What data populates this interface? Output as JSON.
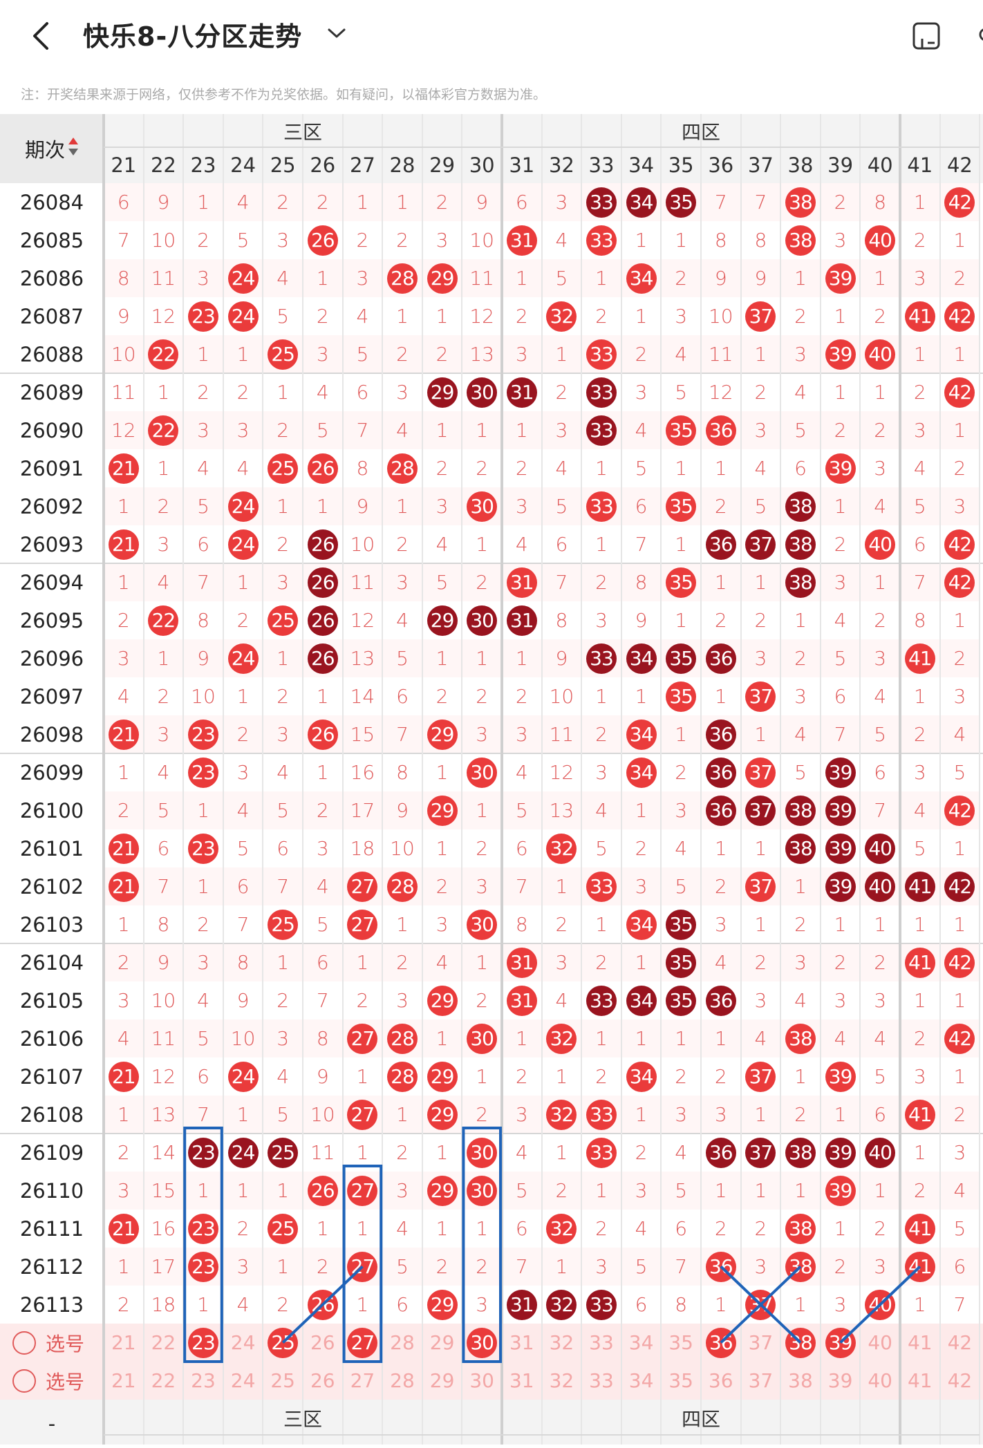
{
  "header": {
    "title": "快乐8-八分区走势",
    "icons": [
      "back-arrow-icon",
      "chevron-down-icon",
      "layout-toggle-icon"
    ]
  },
  "notice": "注：开奖结果来源于网络，仅供参考不作为兑奖依据。如有疑问，以福体彩官方数据为准。",
  "table": {
    "issue_header": "期次",
    "zones": [
      {
        "label": "三区",
        "start": 21,
        "end": 30
      },
      {
        "label": "四区",
        "start": 31,
        "end": 40
      }
    ],
    "columns": [
      "21",
      "22",
      "23",
      "24",
      "25",
      "26",
      "27",
      "28",
      "29",
      "30",
      "31",
      "32",
      "33",
      "34",
      "35",
      "36",
      "37",
      "38",
      "39",
      "40",
      "41",
      "42"
    ],
    "rows": [
      {
        "issue": "26084",
        "cells": [
          "6",
          "9",
          "1",
          "4",
          "2",
          "2",
          "1",
          "1",
          "2",
          "9",
          "6",
          "3",
          "33",
          "34",
          "35",
          "7",
          "7",
          "38",
          "2",
          "8",
          "1",
          "42"
        ],
        "dark": [
          "33",
          "34",
          "35"
        ]
      },
      {
        "issue": "26085",
        "cells": [
          "7",
          "10",
          "2",
          "5",
          "3",
          "26",
          "2",
          "2",
          "3",
          "10",
          "31",
          "4",
          "33",
          "1",
          "1",
          "8",
          "8",
          "38",
          "3",
          "40",
          "2",
          "1"
        ],
        "dark": []
      },
      {
        "issue": "26086",
        "cells": [
          "8",
          "11",
          "3",
          "24",
          "4",
          "1",
          "3",
          "28",
          "29",
          "11",
          "1",
          "5",
          "1",
          "34",
          "2",
          "9",
          "9",
          "1",
          "39",
          "1",
          "3",
          "2"
        ],
        "dark": []
      },
      {
        "issue": "26087",
        "cells": [
          "9",
          "12",
          "23",
          "24",
          "5",
          "2",
          "4",
          "1",
          "1",
          "12",
          "2",
          "32",
          "2",
          "1",
          "3",
          "10",
          "37",
          "2",
          "1",
          "2",
          "41",
          "42"
        ],
        "dark": []
      },
      {
        "issue": "26088",
        "cells": [
          "10",
          "22",
          "1",
          "1",
          "25",
          "3",
          "5",
          "2",
          "2",
          "13",
          "3",
          "1",
          "33",
          "2",
          "4",
          "11",
          "1",
          "3",
          "39",
          "40",
          "1",
          "1"
        ],
        "dark": []
      },
      {
        "issue": "26089",
        "cells": [
          "11",
          "1",
          "2",
          "2",
          "1",
          "4",
          "6",
          "3",
          "29",
          "30",
          "31",
          "2",
          "33",
          "3",
          "5",
          "12",
          "2",
          "4",
          "1",
          "1",
          "2",
          "42"
        ],
        "dark": [
          "29",
          "30",
          "31",
          "33"
        ]
      },
      {
        "issue": "26090",
        "cells": [
          "12",
          "22",
          "3",
          "3",
          "2",
          "5",
          "7",
          "4",
          "1",
          "1",
          "1",
          "3",
          "33",
          "4",
          "35",
          "36",
          "3",
          "5",
          "2",
          "2",
          "3",
          "1"
        ],
        "dark": [
          "33"
        ]
      },
      {
        "issue": "26091",
        "cells": [
          "21",
          "1",
          "4",
          "4",
          "25",
          "26",
          "8",
          "28",
          "2",
          "2",
          "2",
          "4",
          "1",
          "5",
          "1",
          "1",
          "4",
          "6",
          "39",
          "3",
          "4",
          "2"
        ],
        "dark": []
      },
      {
        "issue": "26092",
        "cells": [
          "1",
          "2",
          "5",
          "24",
          "1",
          "1",
          "9",
          "1",
          "3",
          "30",
          "3",
          "5",
          "33",
          "6",
          "35",
          "2",
          "5",
          "38",
          "1",
          "4",
          "5",
          "3"
        ],
        "dark": [
          "38"
        ]
      },
      {
        "issue": "26093",
        "cells": [
          "21",
          "3",
          "6",
          "24",
          "2",
          "26",
          "10",
          "2",
          "4",
          "1",
          "4",
          "6",
          "1",
          "7",
          "1",
          "36",
          "37",
          "38",
          "2",
          "40",
          "6",
          "42"
        ],
        "dark": [
          "26",
          "36",
          "37",
          "38"
        ]
      },
      {
        "issue": "26094",
        "cells": [
          "1",
          "4",
          "7",
          "1",
          "3",
          "26",
          "11",
          "3",
          "5",
          "2",
          "31",
          "7",
          "2",
          "8",
          "35",
          "1",
          "1",
          "38",
          "3",
          "1",
          "7",
          "42"
        ],
        "dark": [
          "26",
          "38"
        ]
      },
      {
        "issue": "26095",
        "cells": [
          "2",
          "22",
          "8",
          "2",
          "25",
          "26",
          "12",
          "4",
          "29",
          "30",
          "31",
          "8",
          "3",
          "9",
          "1",
          "2",
          "2",
          "1",
          "4",
          "2",
          "8",
          "1"
        ],
        "dark": [
          "26",
          "29",
          "30",
          "31"
        ]
      },
      {
        "issue": "26096",
        "cells": [
          "3",
          "1",
          "9",
          "24",
          "1",
          "26",
          "13",
          "5",
          "1",
          "1",
          "1",
          "9",
          "33",
          "34",
          "35",
          "36",
          "3",
          "2",
          "5",
          "3",
          "41",
          "2"
        ],
        "dark": [
          "26",
          "33",
          "34",
          "35",
          "36"
        ]
      },
      {
        "issue": "26097",
        "cells": [
          "4",
          "2",
          "10",
          "1",
          "2",
          "1",
          "14",
          "6",
          "2",
          "2",
          "2",
          "10",
          "1",
          "1",
          "35",
          "1",
          "37",
          "3",
          "6",
          "4",
          "1",
          "3"
        ],
        "dark": []
      },
      {
        "issue": "26098",
        "cells": [
          "21",
          "3",
          "23",
          "2",
          "3",
          "26",
          "15",
          "7",
          "29",
          "3",
          "3",
          "11",
          "2",
          "34",
          "1",
          "36",
          "1",
          "4",
          "7",
          "5",
          "2",
          "4"
        ],
        "dark": [
          "36"
        ]
      },
      {
        "issue": "26099",
        "cells": [
          "1",
          "4",
          "23",
          "3",
          "4",
          "1",
          "16",
          "8",
          "1",
          "30",
          "4",
          "12",
          "3",
          "34",
          "2",
          "36",
          "37",
          "5",
          "39",
          "6",
          "3",
          "5"
        ],
        "dark": [
          "36",
          "39"
        ]
      },
      {
        "issue": "26100",
        "cells": [
          "2",
          "5",
          "1",
          "4",
          "5",
          "2",
          "17",
          "9",
          "29",
          "1",
          "5",
          "13",
          "4",
          "1",
          "3",
          "36",
          "37",
          "38",
          "39",
          "7",
          "4",
          "42"
        ],
        "dark": [
          "36",
          "37",
          "38",
          "39"
        ]
      },
      {
        "issue": "26101",
        "cells": [
          "21",
          "6",
          "23",
          "5",
          "6",
          "3",
          "18",
          "10",
          "1",
          "2",
          "6",
          "32",
          "5",
          "2",
          "4",
          "1",
          "1",
          "38",
          "39",
          "40",
          "5",
          "1"
        ],
        "dark": [
          "38",
          "39",
          "40"
        ]
      },
      {
        "issue": "26102",
        "cells": [
          "21",
          "7",
          "1",
          "6",
          "7",
          "4",
          "27",
          "28",
          "2",
          "3",
          "7",
          "1",
          "33",
          "3",
          "5",
          "2",
          "37",
          "1",
          "39",
          "40",
          "41",
          "42"
        ],
        "dark": [
          "39",
          "40",
          "41",
          "42"
        ]
      },
      {
        "issue": "26103",
        "cells": [
          "1",
          "8",
          "2",
          "7",
          "25",
          "5",
          "27",
          "1",
          "3",
          "30",
          "8",
          "2",
          "1",
          "34",
          "35",
          "3",
          "1",
          "2",
          "1",
          "1",
          "1",
          "1"
        ],
        "dark": [
          "35"
        ]
      },
      {
        "issue": "26104",
        "cells": [
          "2",
          "9",
          "3",
          "8",
          "1",
          "6",
          "1",
          "2",
          "4",
          "1",
          "31",
          "3",
          "2",
          "1",
          "35",
          "4",
          "2",
          "3",
          "2",
          "2",
          "41",
          "42"
        ],
        "dark": [
          "35"
        ]
      },
      {
        "issue": "26105",
        "cells": [
          "3",
          "10",
          "4",
          "9",
          "2",
          "7",
          "2",
          "3",
          "29",
          "2",
          "31",
          "4",
          "33",
          "34",
          "35",
          "36",
          "3",
          "4",
          "3",
          "3",
          "1",
          "1"
        ],
        "dark": [
          "33",
          "34",
          "35",
          "36"
        ]
      },
      {
        "issue": "26106",
        "cells": [
          "4",
          "11",
          "5",
          "10",
          "3",
          "8",
          "27",
          "28",
          "1",
          "30",
          "1",
          "32",
          "1",
          "1",
          "1",
          "1",
          "4",
          "38",
          "4",
          "4",
          "2",
          "42"
        ],
        "dark": []
      },
      {
        "issue": "26107",
        "cells": [
          "21",
          "12",
          "6",
          "24",
          "4",
          "9",
          "1",
          "28",
          "29",
          "1",
          "2",
          "1",
          "2",
          "34",
          "2",
          "2",
          "37",
          "1",
          "39",
          "5",
          "3",
          "1"
        ],
        "dark": []
      },
      {
        "issue": "26108",
        "cells": [
          "1",
          "13",
          "7",
          "1",
          "5",
          "10",
          "27",
          "1",
          "29",
          "2",
          "3",
          "32",
          "33",
          "1",
          "3",
          "3",
          "1",
          "2",
          "1",
          "6",
          "41",
          "2"
        ],
        "dark": []
      },
      {
        "issue": "26109",
        "cells": [
          "2",
          "14",
          "23",
          "24",
          "25",
          "11",
          "1",
          "2",
          "1",
          "30",
          "4",
          "1",
          "33",
          "2",
          "4",
          "36",
          "37",
          "38",
          "39",
          "40",
          "1",
          "3"
        ],
        "dark": [
          "23",
          "24",
          "25",
          "36",
          "37",
          "38",
          "39",
          "40"
        ]
      },
      {
        "issue": "26110",
        "cells": [
          "3",
          "15",
          "1",
          "1",
          "1",
          "26",
          "27",
          "3",
          "29",
          "30",
          "5",
          "2",
          "1",
          "3",
          "5",
          "1",
          "1",
          "1",
          "39",
          "1",
          "2",
          "4"
        ],
        "dark": []
      },
      {
        "issue": "26111",
        "cells": [
          "21",
          "16",
          "23",
          "2",
          "25",
          "1",
          "1",
          "4",
          "1",
          "1",
          "6",
          "32",
          "2",
          "4",
          "6",
          "2",
          "2",
          "38",
          "1",
          "2",
          "41",
          "5"
        ],
        "dark": []
      },
      {
        "issue": "26112",
        "cells": [
          "1",
          "17",
          "23",
          "3",
          "1",
          "2",
          "27",
          "5",
          "2",
          "2",
          "7",
          "1",
          "3",
          "5",
          "7",
          "36",
          "3",
          "38",
          "2",
          "3",
          "41",
          "6"
        ],
        "dark": []
      },
      {
        "issue": "26113",
        "cells": [
          "2",
          "18",
          "1",
          "4",
          "2",
          "26",
          "1",
          "6",
          "29",
          "3",
          "31",
          "32",
          "33",
          "6",
          "8",
          "1",
          "37",
          "1",
          "3",
          "40",
          "1",
          "7"
        ],
        "dark": [
          "31",
          "32",
          "33"
        ]
      }
    ],
    "pick_rows": [
      {
        "label": "选号",
        "selected": [
          "23",
          "25",
          "27",
          "30",
          "36",
          "38",
          "39"
        ]
      },
      {
        "label": "选号",
        "selected": []
      }
    ]
  },
  "colors": {
    "ball_red": "#ea3b3b",
    "ball_dark": "#99141f",
    "number_red": "#e05a5a",
    "annotation_blue": "#1f63b8"
  }
}
